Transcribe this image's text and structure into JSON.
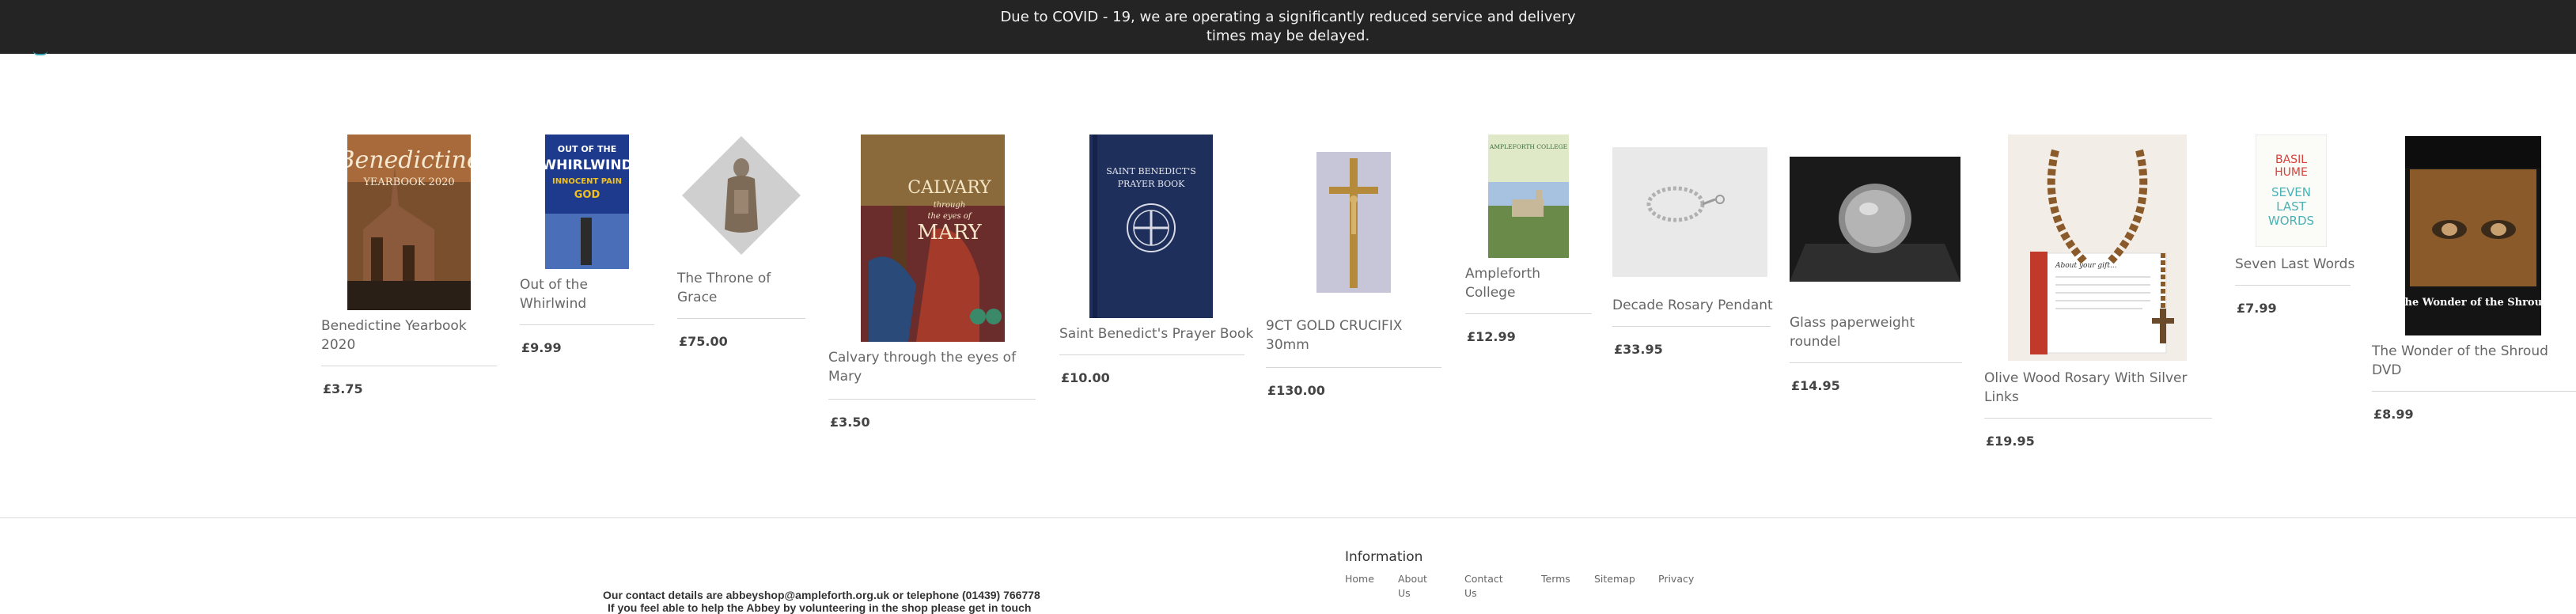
{
  "banner": {
    "text": "Due to COVID - 19, we are operating a significantly reduced service and delivery times may be delayed."
  },
  "products": [
    {
      "name": "Benedictine Yearbook 2020",
      "price": "£3.75",
      "image_text": [
        "Benedictine",
        "YEARBOOK 2020"
      ]
    },
    {
      "name": "Out of the Whirlwind",
      "price": "£9.99",
      "image_text": [
        "OUT OF THE",
        "WHIRLWIND",
        "INNOCENT PAIN",
        "GOD"
      ]
    },
    {
      "name": "The Throne of Grace",
      "price": "£75.00"
    },
    {
      "name": "Calvary through the eyes of Mary",
      "price": "£3.50",
      "image_text": [
        "CALVARY",
        "through",
        "the eyes of",
        "MARY"
      ]
    },
    {
      "name": "Saint Benedict's Prayer Book",
      "price": "£10.00",
      "image_text": [
        "SAINT BENEDICT'S",
        "PRAYER BOOK"
      ]
    },
    {
      "name": "9CT GOLD CRUCIFIX 30mm",
      "price": "£130.00"
    },
    {
      "name": "Ampleforth College",
      "price": "£12.99",
      "image_text": [
        "AMPLEFORTH COLLEGE"
      ]
    },
    {
      "name": "Decade Rosary Pendant",
      "price": "£33.95"
    },
    {
      "name": "Glass paperweight roundel",
      "price": "£14.95"
    },
    {
      "name": "Olive Wood Rosary With Silver Links",
      "price": "£19.95",
      "image_text": [
        "About your gift..."
      ]
    },
    {
      "name": "Seven Last Words",
      "price": "£7.99",
      "image_text": [
        "BASIL",
        "HUME",
        "SEVEN",
        "LAST",
        "WORDS"
      ]
    },
    {
      "name": "The Wonder of the Shroud DVD",
      "price": "£8.99",
      "image_text": [
        "The Wonder of the Shroud"
      ]
    }
  ],
  "footer": {
    "contact_line1": "Our contact details are abbeyshop@ampleforth.org.uk or telephone (01439) 766778",
    "contact_line2": "If you feel able to help the Abbey by volunteering in the shop please get in touch",
    "info_title": "Information",
    "links": [
      "Home",
      "About Us",
      "Contact Us",
      "Terms",
      "Sitemap",
      "Privacy"
    ]
  },
  "colors": {
    "banner_bg": "#242424",
    "text": "#666666",
    "price": "#444444",
    "rule": "#d6d6d6"
  }
}
